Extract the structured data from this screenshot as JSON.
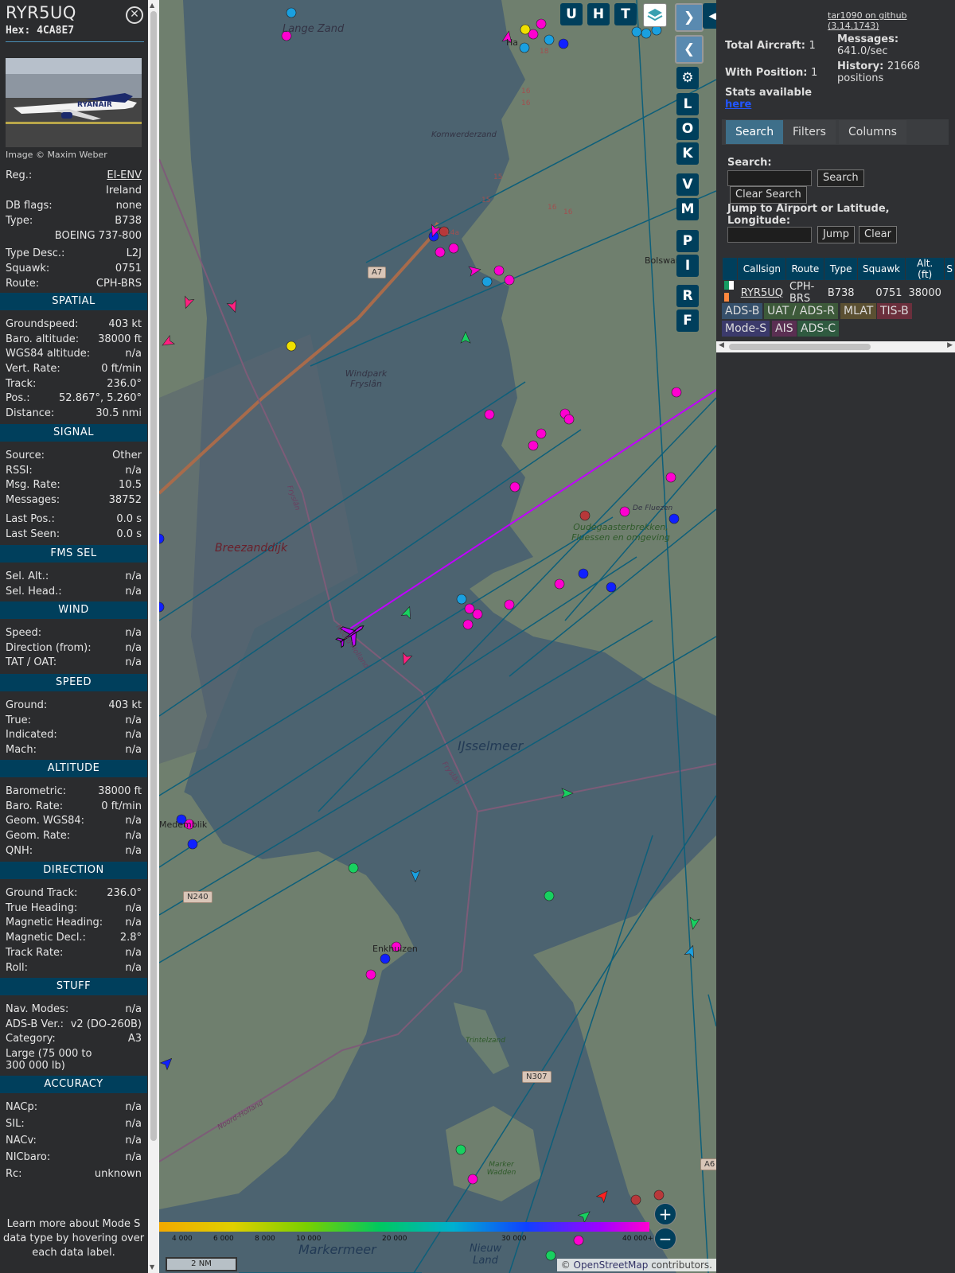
{
  "aircraft": {
    "callsign": "RYR5UQ",
    "hex_label": "Hex: 4CA8E7",
    "photo_credit": "Image © Maxim Weber",
    "details": [
      {
        "k": "Reg.:",
        "v": "EI-ENV"
      },
      {
        "k": "",
        "v": "Ireland"
      },
      {
        "k": "DB flags:",
        "v": "none"
      },
      {
        "k": "Type:",
        "v": "B738"
      },
      {
        "k": "",
        "v": "BOEING 737-800"
      },
      {
        "k": "Type Desc.:",
        "v": "L2J"
      },
      {
        "k": "Squawk:",
        "v": "0751"
      },
      {
        "k": "Route:",
        "v": "CPH-BRS"
      }
    ]
  },
  "sections": {
    "spatial": {
      "title": "SPATIAL",
      "rows": [
        {
          "k": "Groundspeed:",
          "v": "403 kt"
        },
        {
          "k": "Baro. altitude:",
          "v": "38000 ft"
        },
        {
          "k": "WGS84 altitude:",
          "v": "n/a"
        },
        {
          "k": "Vert. Rate:",
          "v": "0 ft/min"
        },
        {
          "k": "Track:",
          "v": "236.0°"
        },
        {
          "k": "Pos.:",
          "v": "52.867°, 5.260°"
        },
        {
          "k": "Distance:",
          "v": "30.5 nmi"
        }
      ]
    },
    "signal": {
      "title": "SIGNAL",
      "rows": [
        {
          "k": "Source:",
          "v": "Other"
        },
        {
          "k": "RSSI:",
          "v": "n/a"
        },
        {
          "k": "Msg. Rate:",
          "v": "10.5"
        },
        {
          "k": "Messages:",
          "v": "38752"
        },
        {
          "k": "Last Pos.:",
          "v": "0.0 s"
        },
        {
          "k": "Last Seen:",
          "v": "0.0 s"
        }
      ]
    },
    "fms": {
      "title": "FMS SEL",
      "rows": [
        {
          "k": "Sel. Alt.:",
          "v": "n/a"
        },
        {
          "k": "Sel. Head.:",
          "v": "n/a"
        }
      ]
    },
    "wind": {
      "title": "WIND",
      "rows": [
        {
          "k": "Speed:",
          "v": "n/a"
        },
        {
          "k": "Direction (from):",
          "v": "n/a"
        },
        {
          "k": "TAT / OAT:",
          "v": "n/a"
        }
      ]
    },
    "speed": {
      "title": "SPEED",
      "rows": [
        {
          "k": "Ground:",
          "v": "403 kt"
        },
        {
          "k": "True:",
          "v": "n/a"
        },
        {
          "k": "Indicated:",
          "v": "n/a"
        },
        {
          "k": "Mach:",
          "v": "n/a"
        }
      ]
    },
    "altitude": {
      "title": "ALTITUDE",
      "rows": [
        {
          "k": "Barometric:",
          "v": "38000 ft"
        },
        {
          "k": "Baro. Rate:",
          "v": "0 ft/min"
        },
        {
          "k": "Geom. WGS84:",
          "v": "n/a"
        },
        {
          "k": "Geom. Rate:",
          "v": "n/a"
        },
        {
          "k": "QNH:",
          "v": "n/a"
        }
      ]
    },
    "direction": {
      "title": "DIRECTION",
      "rows": [
        {
          "k": "Ground Track:",
          "v": "236.0°"
        },
        {
          "k": "True Heading:",
          "v": "n/a"
        },
        {
          "k": "Magnetic Heading:",
          "v": "n/a"
        },
        {
          "k": "Magnetic Decl.:",
          "v": "2.8°"
        },
        {
          "k": "Track Rate:",
          "v": "n/a"
        },
        {
          "k": "Roll:",
          "v": "n/a"
        }
      ]
    },
    "stuff": {
      "title": "STUFF",
      "rows": [
        {
          "k": "Nav. Modes:",
          "v": "n/a"
        },
        {
          "k": "ADS-B Ver.:",
          "v": "v2 (DO-260B)"
        },
        {
          "k": "Category:",
          "v": "A3"
        }
      ],
      "category_desc": "Large (75 000 to 300 000 lb)"
    },
    "accuracy": {
      "title": "ACCURACY",
      "rows": [
        {
          "k": "NACp:",
          "v": "n/a"
        },
        {
          "k": "SIL:",
          "v": "n/a"
        },
        {
          "k": "NACv:",
          "v": "n/a"
        },
        {
          "k": "NICbaro:",
          "v": "n/a"
        },
        {
          "k": "Rc:",
          "v": "unknown"
        }
      ]
    }
  },
  "footer_note": "Learn more about Mode S data type by hovering over each data label.",
  "map": {
    "labels": {
      "lange_zand": "Lange Zand",
      "kornwerderzand": "Kornwerderzand",
      "windpark": "Windpark Fryslân",
      "breezanddijk": "Breezanddijk",
      "bolsward": "Bolsward",
      "oudegaaster": "Oudegaasterbrekken, Fluessen en omgeving",
      "ijsselmeer": "IJsselmeer",
      "medemblik": "Medemblik",
      "enkhuizen": "Enkhuizen",
      "trintelzand": "Trintelzand",
      "marker_wadden": "Marker Wadden",
      "markermeer": "Markermeer",
      "nieuw_land": "Nieuw Land",
      "noord_holland": "Noord-Holland",
      "fryslan": "Fryslân",
      "de_fluezen": "De Fluezen",
      "ha": "Ha"
    },
    "roads": {
      "a7": "A7",
      "n240": "N240",
      "n307": "N307",
      "a6": "A6"
    },
    "road_numbers": [
      "16",
      "16",
      "18",
      "15",
      "15",
      "16",
      "14a",
      "16"
    ],
    "top_buttons": [
      "U",
      "H",
      "T"
    ],
    "side_buttons": [
      "L",
      "O",
      "K",
      "V",
      "M",
      "P",
      "I",
      "R",
      "F"
    ],
    "altitude_scale": [
      "4 000",
      "6 000",
      "8 000",
      "10 000",
      "20 000",
      "30 000",
      "40 000+"
    ],
    "scale_bar": "2 NM",
    "attribution_prefix": "©",
    "attribution_link": "OpenStreetMap",
    "attribution_suffix": "contributors."
  },
  "panel": {
    "github_link": "tar1090 on github (3.14.1743)",
    "total_aircraft": {
      "label": "Total Aircraft:",
      "value": "1"
    },
    "with_position": {
      "label": "With Position:",
      "value": "1"
    },
    "messages": {
      "label": "Messages:",
      "value": "641.0/sec"
    },
    "history": {
      "label": "History:",
      "value": "21668 positions"
    },
    "stats": {
      "label": "Stats available",
      "link": "here"
    },
    "tabs": [
      "Search",
      "Filters",
      "Columns"
    ],
    "search_label": "Search:",
    "search_button": "Search",
    "clear_search_button": "Clear Search",
    "jump_label": "Jump to Airport or Latitude, Longitude:",
    "jump_button": "Jump",
    "clear_button": "Clear",
    "table": {
      "columns": [
        "",
        "Callsign",
        "Route",
        "Type",
        "Squawk",
        "Alt. (ft)",
        "S"
      ],
      "row": {
        "callsign": "RYR5UQ",
        "route": "CPH-BRS",
        "type": "B738",
        "squawk": "0751",
        "alt": "38000"
      }
    },
    "source_chips": [
      {
        "label": "ADS-B",
        "bg": "#36506b"
      },
      {
        "label": "UAT / ADS-R",
        "bg": "#3d5a3a"
      },
      {
        "label": "MLAT",
        "bg": "#5b5032"
      },
      {
        "label": "TIS-B",
        "bg": "#6b2f3c"
      },
      {
        "label": "Mode-S",
        "bg": "#3b3a6b"
      },
      {
        "label": "AIS",
        "bg": "#5a2f52"
      },
      {
        "label": "ADS-C",
        "bg": "#2f5a40"
      }
    ]
  },
  "colors": {
    "accent": "#003f5c",
    "track": "#c000ff",
    "active_tab": "#3e6f8a"
  }
}
